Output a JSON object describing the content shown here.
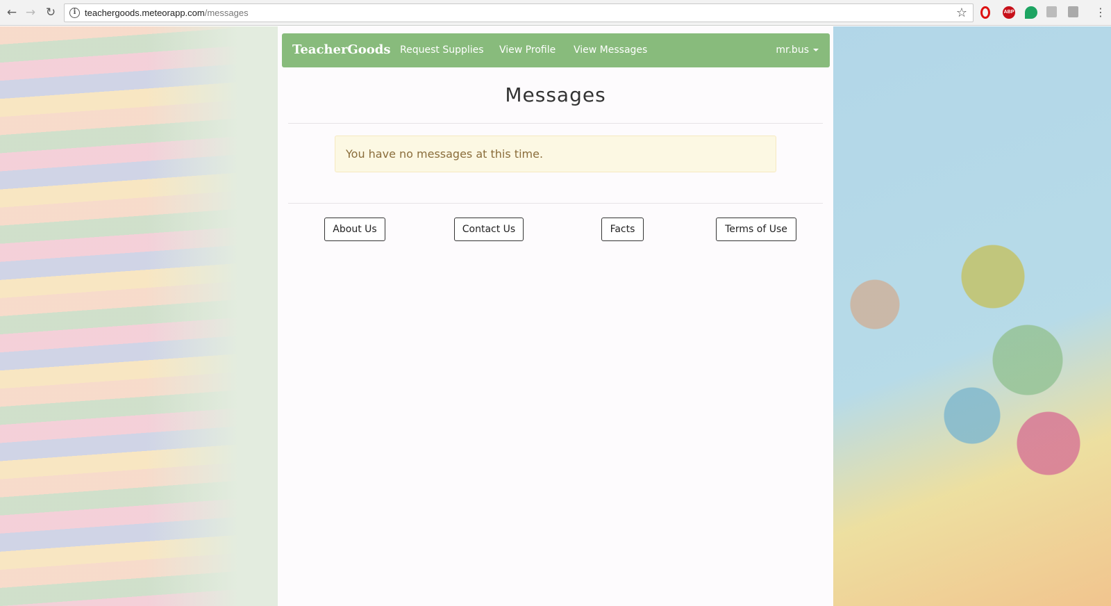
{
  "browser": {
    "url_host": "teachergoods.meteorapp.com",
    "url_path": "/messages",
    "back_icon": "←",
    "forward_icon": "→",
    "reload_icon": "↻",
    "info_icon": "i",
    "star_icon": "☆",
    "menu_icon": "⋮",
    "extensions": {
      "abp_label": "ABP"
    }
  },
  "navbar": {
    "brand": "TeacherGoods",
    "links": [
      "Request Supplies",
      "View Profile",
      "View Messages"
    ],
    "user": "mr.bus",
    "color": "#88bb7c"
  },
  "main": {
    "title": "Messages",
    "alert": "You have no messages at this time.",
    "alert_color": "#fcf8e3"
  },
  "footer": {
    "buttons": [
      "About Us",
      "Contact Us",
      "Facts",
      "Terms of Use"
    ]
  }
}
